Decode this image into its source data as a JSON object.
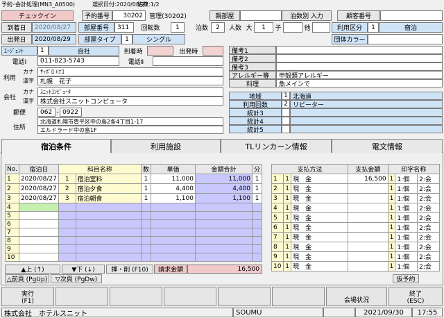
{
  "window": {
    "title": "予約･会計処理(MN3_A0500)",
    "selected_date": "選択日付:2020/08/27",
    "rooms": "泊数:1/2"
  },
  "header": {
    "checkin": "チェックイン",
    "res_no_label": "予約番号",
    "res_no": "30202",
    "mgmt_label": "管理(30202)",
    "parent_room_label": "親部屋",
    "nights_input_label": "泊数別 入力",
    "customer_no_label": "顧客番号"
  },
  "stay": {
    "arrival_label": "到着日",
    "arrival": "2020/08/27",
    "departure_label": "出発日",
    "departure": "2020/08/29",
    "room_no_label": "部屋番号",
    "room_no": "311",
    "turns_label": "回転数",
    "turns": "1",
    "nights_label": "泊数",
    "nights": "2",
    "people_label": "人数",
    "large_label": "大",
    "large": "1",
    "child_label": "子",
    "other_label": "他",
    "usage_label": "利用区分",
    "usage_code": "1",
    "usage": "宿泊",
    "room_type_label": "部屋タイプ",
    "room_type_code": "1",
    "room_type": "シングル",
    "group_color_label": "団体カラー"
  },
  "agent": {
    "label": "ｴｰｼﾞｪﾝﾄ",
    "code": "1",
    "name": "自社",
    "arr_time_label": "到着時",
    "dep_time_label": "出発時"
  },
  "contact": {
    "tel1_label": "電話Ⅰ",
    "tel1": "011-823-5743",
    "tel2_label": "電話Ⅱ",
    "use_label": "利用",
    "kana_label": "カナ",
    "kana": "ｻｯﾎﾟﾛ ﾊﾅｺ",
    "kanji_label": "漢字",
    "kanji": "札幌　花子",
    "company_label": "会社",
    "co_kana": "ｽﾆｯﾄｺﾝﾋﾟｭｰﾀ",
    "co_kanji": "株式会社スニットコンピュータ",
    "zip_label": "郵便",
    "zip1": "062",
    "zip2": "0922",
    "addr_label": "住所",
    "addr1": "北海道札幌市豊平区中の島2条4丁目1-17",
    "addr2": "エルドラード中の島1F"
  },
  "notes": {
    "b1": "備考1",
    "b2": "備考2",
    "b3": "備考3",
    "allergy_label": "アレルギー等",
    "allergy": "甲殻類アレルギー",
    "cuisine_label": "料理",
    "cuisine": "魚メインで"
  },
  "stats": [
    {
      "label": "地域",
      "code": "1",
      "value": "北海道"
    },
    {
      "label": "利用回数",
      "code": "2",
      "value": "リピーター"
    },
    {
      "label": "統計3",
      "code": "",
      "value": ""
    },
    {
      "label": "統計4",
      "code": "",
      "value": ""
    },
    {
      "label": "統計5",
      "code": "",
      "value": ""
    }
  ],
  "tabs": [
    "宿泊条件",
    "利用施設",
    "TLリンカーン情報",
    "電文情報"
  ],
  "items": {
    "headers": [
      "No.",
      "宿泊日",
      "科目名称",
      "数",
      "単価",
      "金額合計",
      "分"
    ],
    "rows": [
      [
        "1",
        "2020/08/27",
        "1",
        "宿泊室料",
        "1",
        "11,000",
        "11,000",
        "1"
      ],
      [
        "2",
        "2020/08/27",
        "2",
        "宿泊夕食",
        "1",
        "4,400",
        "4,400",
        "1"
      ],
      [
        "3",
        "2020/08/27",
        "3",
        "宿泊朝食",
        "1",
        "1,100",
        "1,100",
        "1"
      ],
      [
        "4",
        "",
        "",
        "",
        "",
        "",
        "",
        ""
      ],
      [
        "5",
        "",
        "",
        "",
        "",
        "",
        "",
        ""
      ],
      [
        "6",
        "",
        "",
        "",
        "",
        "",
        "",
        ""
      ],
      [
        "7",
        "",
        "",
        "",
        "",
        "",
        "",
        ""
      ],
      [
        "8",
        "",
        "",
        "",
        "",
        "",
        "",
        ""
      ],
      [
        "9",
        "",
        "",
        "",
        "",
        "",
        "",
        ""
      ],
      [
        "10",
        "",
        "",
        "",
        "",
        "",
        "",
        ""
      ]
    ]
  },
  "payments": {
    "headers": [
      "支払方法",
      "支払金額",
      "印字名称"
    ],
    "rows": [
      [
        "1",
        "1",
        "現　金",
        "16,500",
        "1",
        "1:個",
        "2:会"
      ],
      [
        "2",
        "1",
        "現　金",
        "",
        "1",
        "1:個",
        "2:会"
      ],
      [
        "3",
        "1",
        "現　金",
        "",
        "1",
        "1:個",
        "2:会"
      ],
      [
        "4",
        "1",
        "現　金",
        "",
        "1",
        "1:個",
        "2:会"
      ],
      [
        "5",
        "1",
        "現　金",
        "",
        "1",
        "1:個",
        "2:会"
      ],
      [
        "6",
        "1",
        "現　金",
        "",
        "1",
        "1:個",
        "2:会"
      ],
      [
        "7",
        "1",
        "現　金",
        "",
        "1",
        "1:個",
        "2:会"
      ],
      [
        "8",
        "1",
        "現　金",
        "",
        "1",
        "1:個",
        "2:会"
      ],
      [
        "9",
        "1",
        "現　金",
        "",
        "1",
        "1:個",
        "2:会"
      ],
      [
        "10",
        "1",
        "現　金",
        "",
        "1",
        "1:個",
        "2:会"
      ]
    ]
  },
  "controls": {
    "up": "▲上 (↑)",
    "down": "▼下 (↓)",
    "insdel": "挿・削 (F10)",
    "billing_label": "請求金額",
    "billing": "16,500",
    "prev": "△前頁 (PgUp)",
    "next": "▽次頁 (PgDw)",
    "prov": "仮予約"
  },
  "footer": {
    "exec": "実行",
    "exec_key": "(F1)",
    "venue": "会場状況",
    "end": "終了",
    "end_key": "(ESC)"
  },
  "status": {
    "company": "株式会社　ホテルスニット",
    "user": "SOUMU",
    "date": "2021/09/30",
    "time": "17:55"
  }
}
